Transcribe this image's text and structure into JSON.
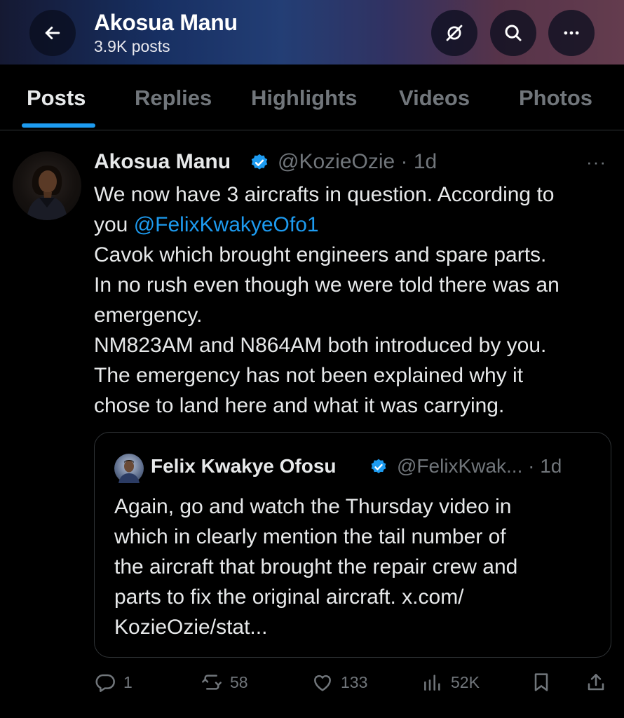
{
  "header": {
    "title": "Akosua Manu",
    "subtitle": "3.9K posts",
    "back_icon": "arrow-left-icon",
    "grok_icon": "grok-icon",
    "search_icon": "search-icon",
    "more_icon": "more-horizontal-icon"
  },
  "tabs": [
    {
      "label": "Posts",
      "active": true
    },
    {
      "label": "Replies"
    },
    {
      "label": "Highlights"
    },
    {
      "label": "Videos"
    },
    {
      "label": "Photos"
    }
  ],
  "tweet": {
    "name": "Akosua Manu",
    "handle_time": "@KozieOzie · 1d",
    "more": "···",
    "lines": [
      "We now have 3 aircrafts in question. According to",
      "you ",
      "Cavok which brought engineers and  spare parts.",
      "In no rush even though we were told there was an",
      "emergency.",
      "NM823AM and N864AM both introduced by you.",
      "The emergency has not been explained why it",
      "chose to land here and what it was carrying."
    ],
    "mention": "@FelixKwakyeOfo1",
    "quote": {
      "name": "Felix Kwakye Ofosu",
      "handle_time": "@FelixKwak... · 1d",
      "lines": [
        "Again, go and watch the Thursday video in",
        "which in clearly mention the tail number of",
        "the aircraft that brought the repair crew and",
        "parts to fix the original aircraft. x.com/",
        "KozieOzie/stat..."
      ]
    },
    "actions": {
      "replies": "1",
      "reposts": "58",
      "likes": "133",
      "views": "52K"
    }
  },
  "colors": {
    "background": "#000000",
    "accent": "#1d9bf0",
    "text": "#e7e9ea",
    "muted": "#71767b",
    "border": "#2f3336"
  }
}
